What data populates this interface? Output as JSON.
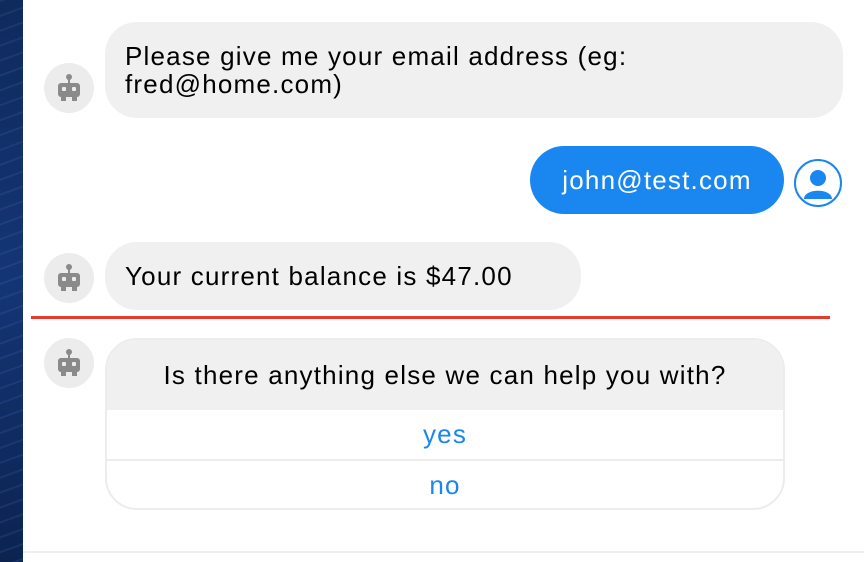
{
  "messages": [
    {
      "sender": "bot",
      "text": "Please give me your email address (eg: fred@home.com)"
    },
    {
      "sender": "user",
      "text": "john@test.com"
    },
    {
      "sender": "bot",
      "text": "Your current balance is $47.00"
    }
  ],
  "prompt": {
    "question": "Is there anything else we can help you with?",
    "options": [
      "yes",
      "no"
    ]
  },
  "colors": {
    "accent": "#1a86f0",
    "bot_bubble": "#f0f0f0",
    "divider": "#e53a2e"
  },
  "icons": {
    "bot_avatar": "robot-icon",
    "user_avatar": "user-icon"
  }
}
